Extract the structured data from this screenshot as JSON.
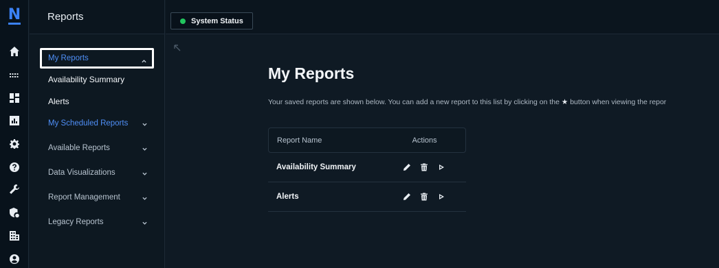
{
  "rail": {
    "logo": "N",
    "icons": [
      "home-icon",
      "grid-dots-icon",
      "dashboard-icon",
      "chart-icon",
      "gear-icon",
      "help-icon",
      "wrench-icon",
      "shield-icon",
      "building-icon",
      "user-icon"
    ]
  },
  "sidebar": {
    "title": "Reports",
    "items": [
      {
        "label": "My Reports"
      },
      {
        "label": "Availability Summary"
      },
      {
        "label": "Alerts"
      },
      {
        "label": "My Scheduled Reports"
      },
      {
        "label": "Available Reports"
      },
      {
        "label": "Data Visualizations"
      },
      {
        "label": "Report Management"
      },
      {
        "label": "Legacy Reports"
      }
    ]
  },
  "topbar": {
    "status_label": "System Status",
    "status_color": "#22c55e"
  },
  "main": {
    "title": "My Reports",
    "description_before": "Your saved reports are shown below. You can add a new report to this list by clicking on the",
    "description_star": "★",
    "description_after": "button when viewing the repor",
    "table": {
      "headers": {
        "name": "Report Name",
        "actions": "Actions"
      },
      "rows": [
        {
          "name": "Availability Summary"
        },
        {
          "name": "Alerts"
        }
      ]
    }
  },
  "colors": {
    "accent": "#4f8ff7",
    "background": "#0f1a24",
    "sidebar": "#0d1821"
  }
}
